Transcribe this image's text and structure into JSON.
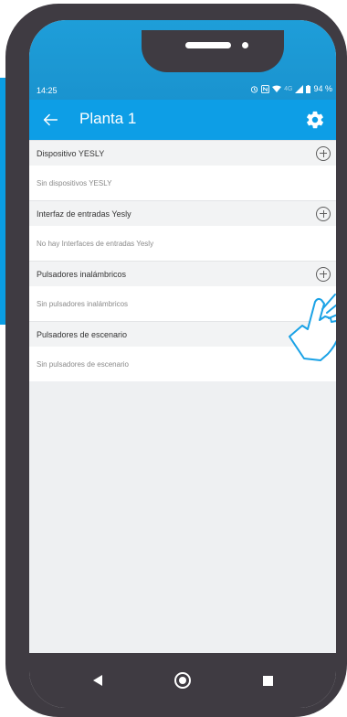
{
  "status_bar": {
    "time": "14:25",
    "network_label": "4G",
    "battery": "94 %",
    "icons": [
      "alarm-icon",
      "nfc-icon",
      "wifi-icon",
      "signal-icon",
      "battery-icon"
    ]
  },
  "app_bar": {
    "title": "Planta 1",
    "back_icon": "arrow-left-icon",
    "settings_icon": "gear-icon"
  },
  "sections": [
    {
      "title": "Dispositivo YESLY",
      "empty_text": "Sin dispositivos YESLY"
    },
    {
      "title": "Interfaz de entradas Yesly",
      "empty_text": "No hay Interfaces de entradas Yesly"
    },
    {
      "title": "Pulsadores inalámbricos",
      "empty_text": "Sin pulsadores inalámbricos"
    },
    {
      "title": "Pulsadores de escenario",
      "empty_text": "Sin pulsadores de escenario"
    }
  ],
  "colors": {
    "primary": "#0d9ee6",
    "phone_frame": "#3f3b42",
    "header_bg": "#f2f3f4",
    "list_bg": "#ffffff",
    "screen_bg": "#eef0f2"
  },
  "nav": {
    "buttons": [
      "nav-back-icon",
      "nav-home-icon",
      "nav-recent-icon"
    ]
  }
}
